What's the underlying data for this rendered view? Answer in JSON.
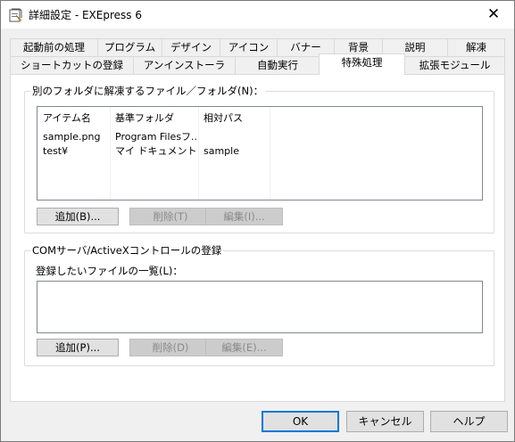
{
  "window": {
    "title": "詳細設定 - EXEpress 6",
    "close_glyph": "✕",
    "app_icon": "settings-app-icon"
  },
  "tabs_row1": [
    {
      "label": "起動前の処理"
    },
    {
      "label": "プログラム"
    },
    {
      "label": "デザイン"
    },
    {
      "label": "アイコン"
    },
    {
      "label": "バナー"
    },
    {
      "label": "背景"
    },
    {
      "label": "説明"
    },
    {
      "label": "解凍"
    }
  ],
  "tabs_row2": [
    {
      "label": "ショートカットの登録"
    },
    {
      "label": "アンインストーラ"
    },
    {
      "label": "自動実行"
    },
    {
      "label": "特殊処理",
      "active": true
    },
    {
      "label": "拡張モジュール"
    }
  ],
  "folder_group": {
    "title": "別のフォルダに解凍するファイル／フォルダ(N)：",
    "columns": [
      "アイテム名",
      "基準フォルダ",
      "相対パス"
    ],
    "rows": [
      [
        "sample.png",
        "Program Filesフ...",
        ""
      ],
      [
        "test¥",
        "マイ ドキュメント ...",
        "sample"
      ]
    ],
    "add_label": "追加(B)...",
    "delete_label": "削除(T)",
    "edit_label": "編集(I)..."
  },
  "com_group": {
    "title": "COMサーバ/ActiveXコントロールの登録",
    "list_label": "登録したいファイルの一覧(L)：",
    "add_label": "追加(P)...",
    "delete_label": "削除(D)",
    "edit_label": "編集(E)..."
  },
  "footer": {
    "ok_label": "OK",
    "cancel_label": "キャンセル",
    "help_label": "ヘルプ"
  },
  "colors": {
    "accent": "#0078d7",
    "panel": "#ffffff",
    "window": "#f0f0f0"
  }
}
